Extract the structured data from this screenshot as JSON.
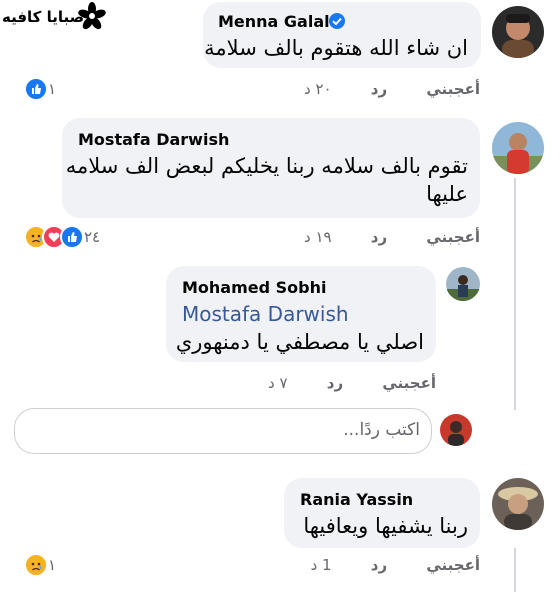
{
  "watermark": {
    "text": "صبايا كافيه"
  },
  "comments": [
    {
      "author": "Menna Galal",
      "verified": true,
      "text_lines": [
        "ان شاء الله هتقوم بالف سلامة"
      ],
      "time": "٢٠ د",
      "like_label": "أعجبني",
      "reply_label": "رد",
      "reaction_count": "١",
      "reaction_icons": [
        "like-icon"
      ]
    },
    {
      "author": "Mostafa Darwish",
      "text_lines": [
        "تقوم بالف سلامه ربنا يخليكم لبعض الف سلامه",
        "عليها"
      ],
      "time": "١٩ د",
      "like_label": "أعجبني",
      "reply_label": "رد",
      "reaction_count": "٢٤",
      "reaction_icons": [
        "like-icon",
        "love-icon",
        "sad-icon"
      ]
    },
    {
      "author": "Mohamed Sobhi",
      "mention": "Mostafa Darwish",
      "text_lines": [
        "اصلي يا مصطفي يا دمنهوري"
      ],
      "time": "٧ د",
      "like_label": "أعجبني",
      "reply_label": "رد"
    },
    {
      "author": "Rania Yassin",
      "text_lines": [
        "ربنا يشفيها ويعافيها"
      ],
      "time": "1 د",
      "like_label": "أعجبني",
      "reply_label": "رد",
      "reaction_count": "١",
      "reaction_icons": [
        "sad-icon"
      ]
    }
  ],
  "reply_input": {
    "placeholder": "اكتب ردًا..."
  },
  "colors": {
    "bubble": "#f0f2f5",
    "link": "#385898",
    "like_blue": "#1877f2",
    "love_red": "#f33e58",
    "sad_yellow": "#f7b125"
  }
}
